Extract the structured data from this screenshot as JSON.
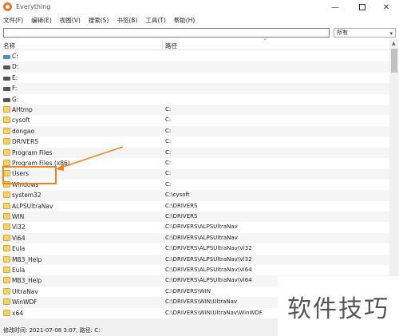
{
  "window": {
    "title": "Everything"
  },
  "menu": [
    "文件(F)",
    "编辑(E)",
    "视图(V)",
    "搜索(S)",
    "书签(B)",
    "工具(T)",
    "帮助(H)"
  ],
  "search": {
    "value": "",
    "filter": "所有"
  },
  "columns": {
    "name": "名称",
    "path": "路径"
  },
  "rows": [
    {
      "name": "C:",
      "path": "",
      "icon": "drive-icon"
    },
    {
      "name": "D:",
      "path": "",
      "icon": "drive-icon"
    },
    {
      "name": "E:",
      "path": "",
      "icon": "drive-icon"
    },
    {
      "name": "F:",
      "path": "",
      "icon": "drive-icon"
    },
    {
      "name": "G:",
      "path": "",
      "icon": "drive-icon"
    },
    {
      "name": "AHtmp",
      "path": "C:",
      "icon": "folder-icon"
    },
    {
      "name": "cysoft",
      "path": "C:",
      "icon": "folder-icon"
    },
    {
      "name": "dongao",
      "path": "C:",
      "icon": "folder-icon"
    },
    {
      "name": "DRIVERS",
      "path": "C:",
      "icon": "folder-icon"
    },
    {
      "name": "Program Files",
      "path": "C:",
      "icon": "folder-icon"
    },
    {
      "name": "Program Files (x86)",
      "path": "C:",
      "icon": "folder-icon"
    },
    {
      "name": "Users",
      "path": "C:",
      "icon": "folder-icon"
    },
    {
      "name": "Windows",
      "path": "C:",
      "icon": "folder-icon"
    },
    {
      "name": "system32",
      "path": "C:\\cysoft",
      "icon": "folder-icon"
    },
    {
      "name": "ALPSUltraNav",
      "path": "C:\\DRIVERS",
      "icon": "folder-icon"
    },
    {
      "name": "WIN",
      "path": "C:\\DRIVERS",
      "icon": "folder-icon"
    },
    {
      "name": "Vi32",
      "path": "C:\\DRIVERS\\ALPSUltraNav",
      "icon": "folder-icon"
    },
    {
      "name": "Vi64",
      "path": "C:\\DRIVERS\\ALPSUltraNav",
      "icon": "folder-icon"
    },
    {
      "name": "Eula",
      "path": "C:\\DRIVERS\\ALPSUltraNav\\Vi32",
      "icon": "folder-icon"
    },
    {
      "name": "MB3_Help",
      "path": "C:\\DRIVERS\\ALPSUltraNav\\Vi32",
      "icon": "folder-icon"
    },
    {
      "name": "Eula",
      "path": "C:\\DRIVERS\\ALPSUltraNav\\Vi64",
      "icon": "folder-icon"
    },
    {
      "name": "MB3_Help",
      "path": "C:\\DRIVERS\\ALPSUltraNav\\Vi64",
      "icon": "folder-icon"
    },
    {
      "name": "UltraNav",
      "path": "C:\\DRIVERS\\WIN",
      "icon": "folder-icon"
    },
    {
      "name": "WinWDF",
      "path": "C:\\DRIVERS\\WIN\\UltraNav",
      "icon": "folder-icon"
    },
    {
      "name": "x64",
      "path": "C:\\DRIVERS\\WIN\\UltraNav\\WinWDF",
      "icon": "folder-icon"
    }
  ],
  "status": {
    "text": "修改时间: 2021-07-08 3:07, 路径: C:"
  },
  "watermark": {
    "text": "软件技巧"
  },
  "colors": {
    "annotation": "#f0831e",
    "folder": "#f6d36a",
    "accent": "#e8752a"
  }
}
